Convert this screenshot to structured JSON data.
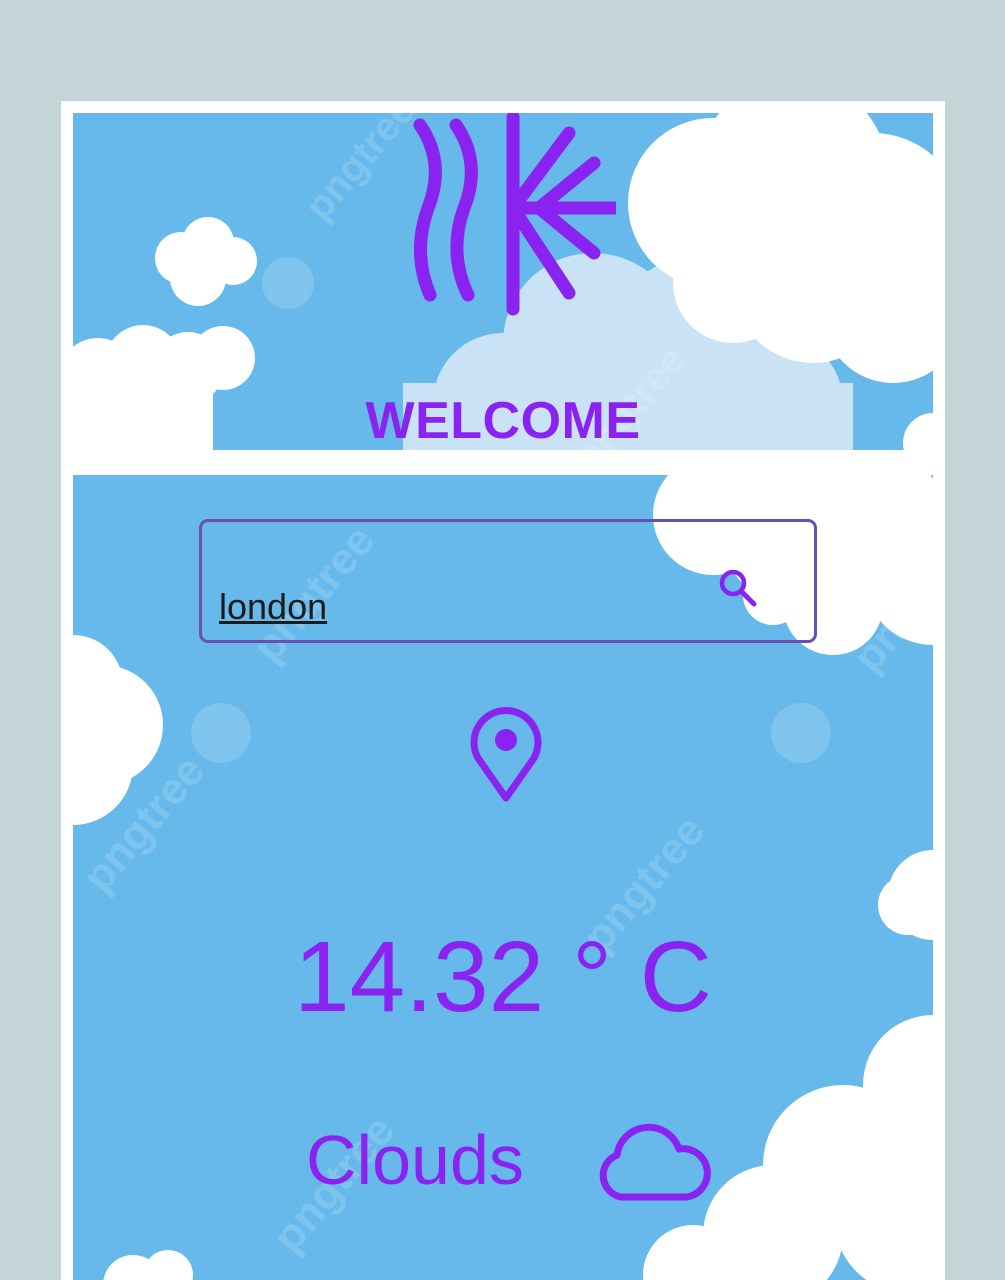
{
  "header": {
    "logo_icon": "wind-snowflake-icon",
    "welcome_text": "WELCOME"
  },
  "search": {
    "value": "london",
    "icon": "search-icon"
  },
  "weather": {
    "location_icon": "map-pin-icon",
    "temperature": "14.32 ° C",
    "condition": "Clouds",
    "condition_icon": "cloud-icon"
  },
  "colors": {
    "page_background": "#c4d5d8",
    "sky": "#66b9ea",
    "accent": "#8b23f0",
    "search_border": "#6a4fb3"
  }
}
